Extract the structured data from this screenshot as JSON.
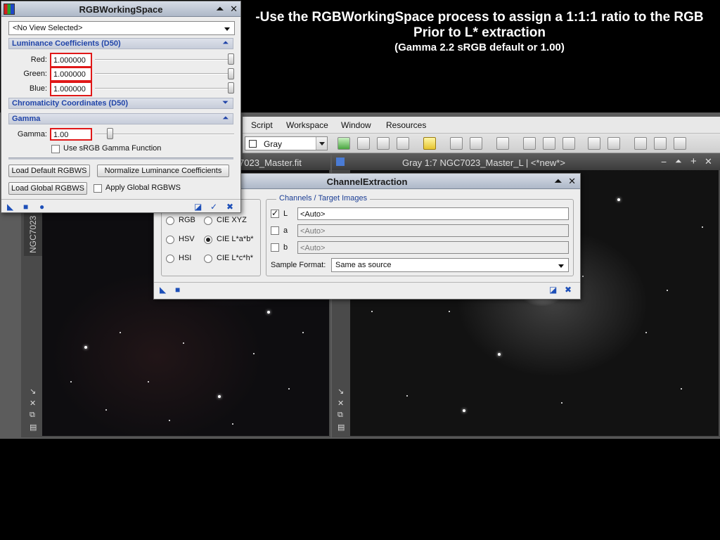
{
  "caption": {
    "line1": "-Use the RGBWorkingSpace process to assign a 1:1:1 ratio to the RGB",
    "line2": "Prior to L* extraction",
    "line3": "(Gamma 2.2 sRGB default or 1.00)"
  },
  "menubar": {
    "items": [
      "Script",
      "Workspace",
      "Window",
      "Resources"
    ]
  },
  "toolbar": {
    "gray_combo": "Gray"
  },
  "image_windows": {
    "left_title": "7023_Master.fit",
    "left_sidetab": "NGC7023",
    "right_title": "Gray 1:7 NGC7023_Master_L | <*new*>"
  },
  "rgbws": {
    "title": "RGBWorkingSpace",
    "view_combo": "<No View Selected>",
    "luminance_section": "Luminance Coefficients (D50)",
    "red_label": "Red:",
    "red_value": "1.000000",
    "green_label": "Green:",
    "green_value": "1.000000",
    "blue_label": "Blue:",
    "blue_value": "1.000000",
    "chromaticity_section": "Chromaticity Coordinates (D50)",
    "gamma_section": "Gamma",
    "gamma_label": "Gamma:",
    "gamma_value": "1.00",
    "use_srgb_label": "Use sRGB Gamma Function",
    "use_srgb_checked": false,
    "load_default_btn": "Load Default RGBWS",
    "normalize_btn": "Normalize Luminance Coefficients",
    "load_global_btn": "Load Global RGBWS",
    "apply_global_label": "Apply Global RGBWS",
    "apply_global_checked": false
  },
  "channel_extraction": {
    "title": "ChannelExtraction",
    "color_spaces": [
      {
        "label": "RGB",
        "checked": false
      },
      {
        "label": "CIE XYZ",
        "checked": false
      },
      {
        "label": "HSV",
        "checked": false
      },
      {
        "label": "CIE L*a*b*",
        "checked": true
      },
      {
        "label": "HSI",
        "checked": false
      },
      {
        "label": "CIE L*c*h*",
        "checked": false
      }
    ],
    "channels_group": "Channels / Target Images",
    "channel_L": "L",
    "channel_L_value": "<Auto>",
    "channel_a": "a",
    "channel_a_value": "<Auto>",
    "channel_b": "b",
    "channel_b_value": "<Auto>",
    "sample_format_label": "Sample Format:",
    "sample_format_value": "Same as source"
  }
}
